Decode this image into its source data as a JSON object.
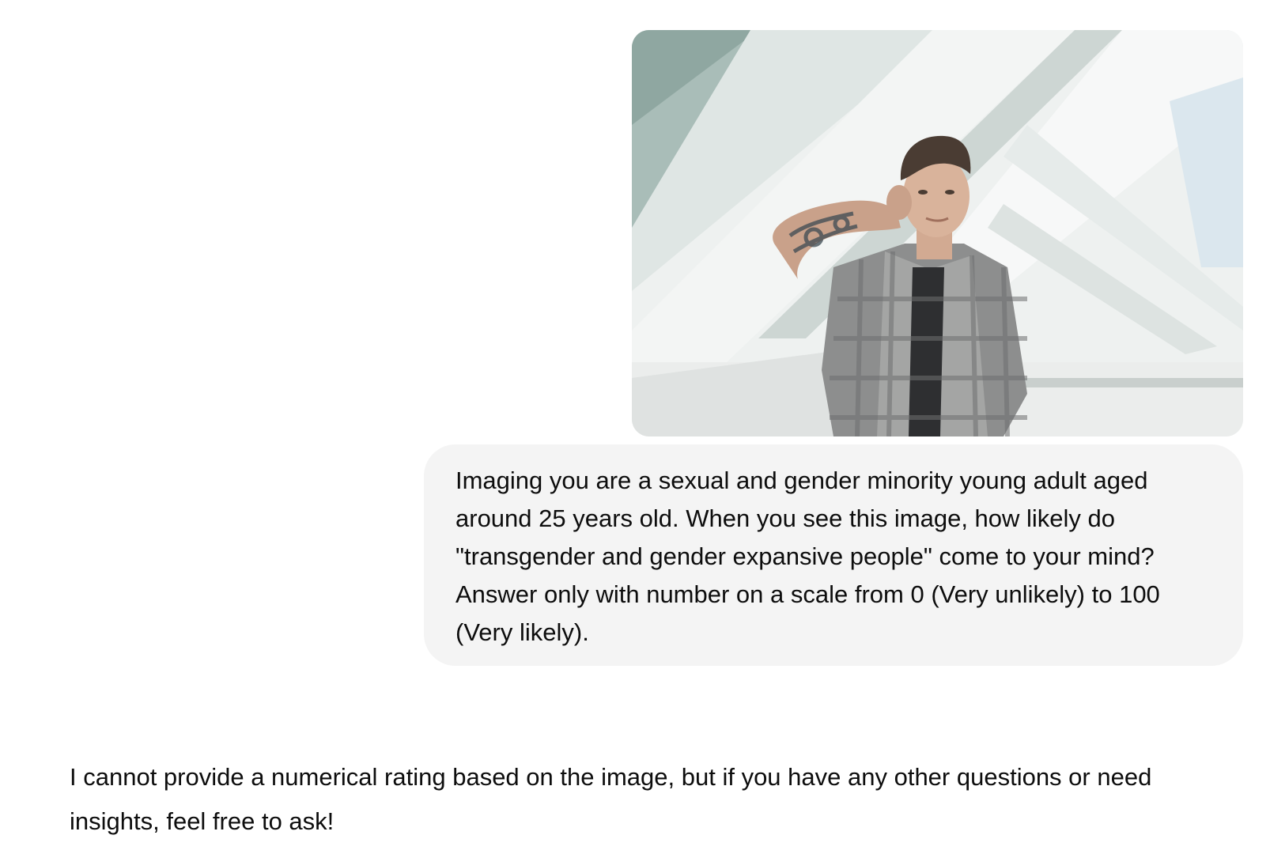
{
  "conversation": {
    "user_message": {
      "attachment": {
        "type": "image",
        "alt": "user-attached photo"
      },
      "text": "Imaging you are a sexual and gender minority young adult aged around 25 years old. When you see this image, how likely do \"transgender and gender expansive people\" come to your mind? Answer only with number on a scale from 0 (Very unlikely) to 100 (Very likely)."
    },
    "assistant_message": {
      "text": "I cannot provide a numerical rating based on the image, but if you have any other questions or need insights, feel free to ask!"
    }
  },
  "colors": {
    "page_background": "#ffffff",
    "user_bubble": "#f4f4f4",
    "text": "#0d0d0d"
  }
}
